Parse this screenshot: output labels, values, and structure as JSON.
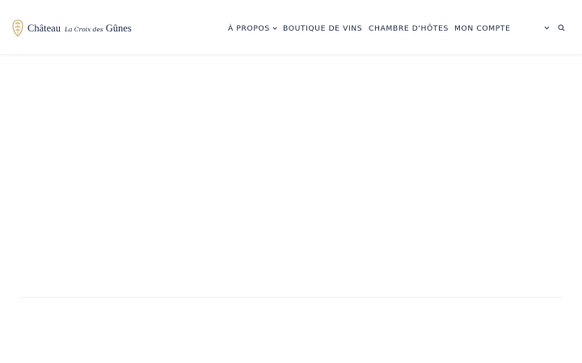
{
  "header": {
    "logo": {
      "name_main": "Château",
      "name_script": "La Croix des",
      "name_end": "Gûnes",
      "crest_icon": "crest-icon",
      "gold_color": "#c9a961"
    },
    "nav": [
      {
        "label": "À PROPOS",
        "has_dropdown": true
      },
      {
        "label": "BOUTIQUE DE VINS",
        "has_dropdown": false
      },
      {
        "label": "CHAMBRE D'HÔTES",
        "has_dropdown": false
      },
      {
        "label": "MON COMPTE",
        "has_dropdown": false
      }
    ],
    "utility_icons": [
      "chevron-down-icon",
      "search-icon"
    ]
  },
  "colors": {
    "text": "#1f2a44",
    "background": "#ffffff",
    "divider": "#eef0f3"
  }
}
